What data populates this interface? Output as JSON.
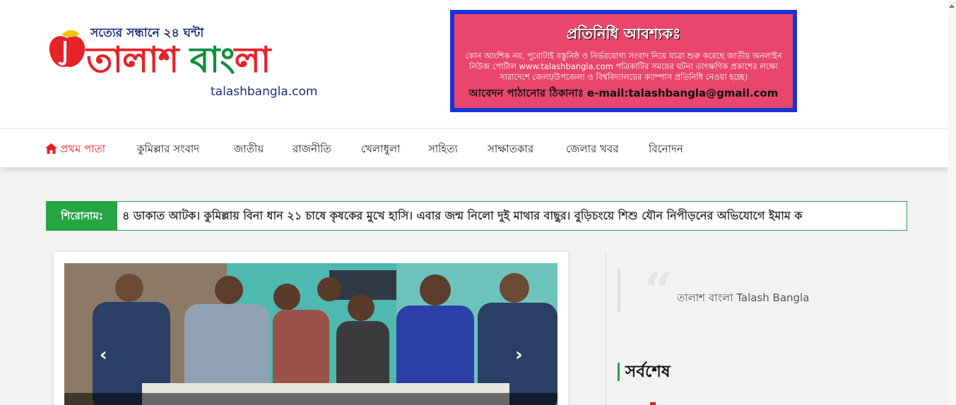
{
  "header": {
    "logo_tagline": "সত্যের সন্ধানে ২৪ ঘন্টা",
    "logo_name_red": "তালাশ ",
    "logo_name_green": "বা",
    "logo_name_rest": "ংলা",
    "logo_domain": "talashbangla.com"
  },
  "ad": {
    "title": "প্রতিনিধি আবশ্যকঃ",
    "body": "কোন আংশিক নয়, পুরোটাই বস্তুনিষ্ঠ ও নির্ভরযোগ্য সংবাদ নিয়ে যাত্রা শুরু করেছে জাতীয় অনলাইন নিউজ পোর্টাল www.talashbangla.com পত্রিকাটির সময়ের ঘটনা তাৎক্ষণিক প্রকাশের লক্ষ্যে সারাদেশে জেলা/উপজেলা ও বিশ্ববিদ্যালয়ের ক্যাম্পাস প্রতিনিধি নেওয়া হচ্ছে।",
    "contact": "আবেদন পাঠানোর ঠিকানাঃ e-mail:talashbangla@gmail.com"
  },
  "nav": {
    "items": [
      {
        "label": "প্রথম পাতা"
      },
      {
        "label": "কুমিল্লার সংবাদ"
      },
      {
        "label": "জাতীয়"
      },
      {
        "label": "রাজনীতি"
      },
      {
        "label": "খেলাধুলা"
      },
      {
        "label": "সাহিত্য"
      },
      {
        "label": "সাক্ষাতকার"
      },
      {
        "label": "জেলার খবর"
      },
      {
        "label": "বিনোদন"
      }
    ]
  },
  "ticker": {
    "label": "শিরোনাম:",
    "text": "৪ ডাকাত আটক। কুমিল্লায় বিনা ধান ২১ চাষে কৃষকের মুখে হাসি। এবার জন্ম নিলো দুই মাথার বাছুর। বুড়িচংয়ে শিশু যৌন নিপীড়নের অভিযোগে ইমাম ক"
  },
  "slider": {
    "prev": "‹",
    "next": "›"
  },
  "sidebar": {
    "quote_text": "তালাশ বাংলা Talash Bangla",
    "section_title": "সর্বশেষ"
  },
  "colors": {
    "accent_red": "#e61b23",
    "accent_green": "#27a444",
    "ad_blue": "#1734d8",
    "ad_pink": "#e8466a"
  },
  "icons": {
    "home": "home-icon",
    "quote": "quote-icon"
  }
}
